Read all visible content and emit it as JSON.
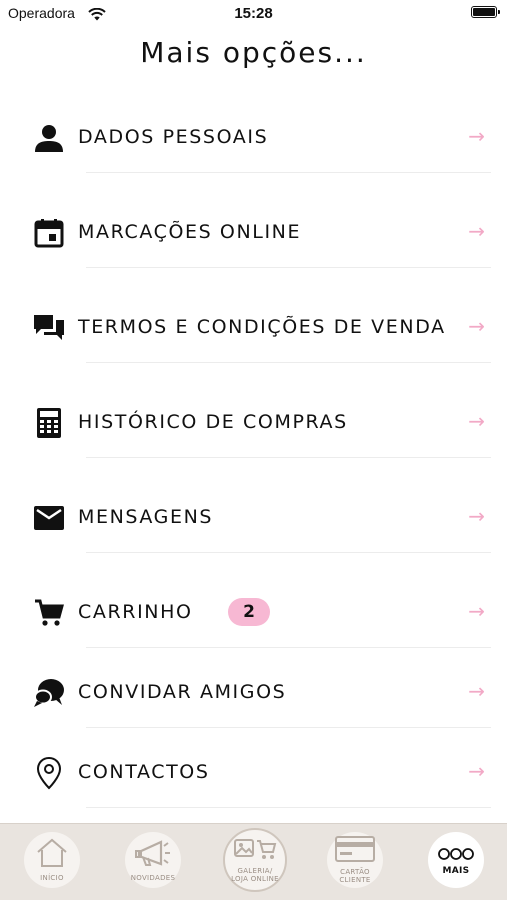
{
  "status_bar": {
    "carrier": "Operadora",
    "time": "15:28"
  },
  "page": {
    "title": "Mais opções..."
  },
  "colors": {
    "accent_pink": "#f2a9c6",
    "badge_pink": "#f7b8d3",
    "tabbar_bg": "#e9e4df"
  },
  "menu": {
    "items": [
      {
        "label": "DADOS PESSOAIS",
        "icon": "person-icon"
      },
      {
        "label": "MARCAÇÕES ONLINE",
        "icon": "calendar-icon"
      },
      {
        "label": "TERMOS E CONDIÇÕES DE VENDA",
        "icon": "chat-bubbles-icon"
      },
      {
        "label": "HISTÓRICO DE COMPRAS",
        "icon": "calculator-icon"
      },
      {
        "label": "MENSAGENS",
        "icon": "envelope-icon"
      },
      {
        "label": "CARRINHO",
        "icon": "cart-icon",
        "badge": "2"
      },
      {
        "label": "CONVIDAR AMIGOS",
        "icon": "speech-bubbles-icon"
      },
      {
        "label": "CONTACTOS",
        "icon": "location-pin-icon"
      }
    ],
    "arrow": "→"
  },
  "tabbar": {
    "tabs": [
      {
        "label": "INÍCIO",
        "icon": "home-icon"
      },
      {
        "label": "NOVIDADES",
        "icon": "megaphone-icon"
      },
      {
        "label": "GALERIA/ LOJA ONLINE",
        "icon": "gallery-cart-icon"
      },
      {
        "label": "CARTÃO CLIENTE",
        "icon": "card-icon"
      },
      {
        "label": "MAIS",
        "icon": "more-icon",
        "active": true
      }
    ]
  }
}
